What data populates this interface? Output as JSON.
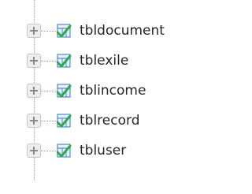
{
  "tree": {
    "items": [
      {
        "label": "tbldocument",
        "icon": "table-icon",
        "expander_icon": "plus-expand-icon"
      },
      {
        "label": "tblexile",
        "icon": "table-icon",
        "expander_icon": "plus-expand-icon"
      },
      {
        "label": "tblincome",
        "icon": "table-icon",
        "expander_icon": "plus-expand-icon"
      },
      {
        "label": "tblrecord",
        "icon": "table-icon",
        "expander_icon": "plus-expand-icon"
      },
      {
        "label": "tbluser",
        "icon": "table-icon",
        "expander_icon": "plus-expand-icon"
      }
    ]
  },
  "colors": {
    "icon_green": "#2fa84f",
    "icon_blue": "#2b79c2",
    "text": "#262626"
  }
}
